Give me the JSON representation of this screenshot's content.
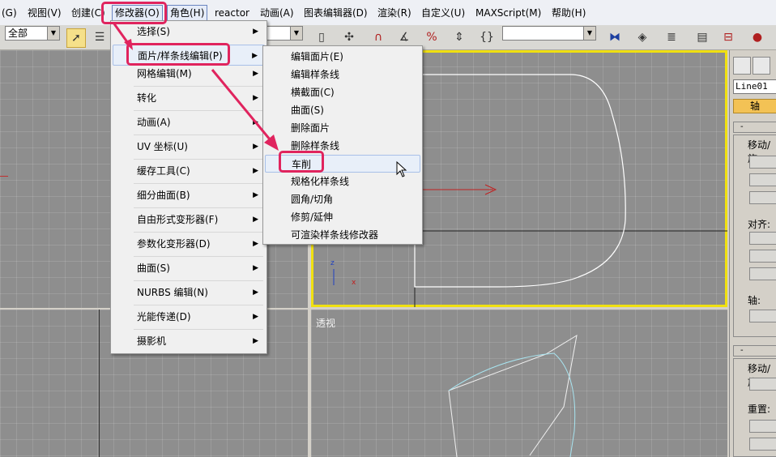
{
  "menubar": {
    "items": [
      "(G)",
      "视图(V)",
      "创建(C)",
      "修改器(O)",
      "角色(H)",
      "reactor",
      "动画(A)",
      "图表编辑器(D)",
      "渲染(R)",
      "自定义(U)",
      "MAXScript(M)",
      "帮助(H)"
    ]
  },
  "toolbar": {
    "selection_filter": "全部"
  },
  "modifier_menu": {
    "items": [
      "选择(S)",
      "面片/样条线编辑(P)",
      "网格编辑(M)",
      "转化",
      "动画(A)",
      "UV 坐标(U)",
      "缓存工具(C)",
      "细分曲面(B)",
      "自由形式变形器(F)",
      "参数化变形器(D)",
      "曲面(S)",
      "NURBS 编辑(N)",
      "光能传递(D)",
      "摄影机"
    ]
  },
  "submenu": {
    "items": [
      "编辑面片(E)",
      "编辑样条线",
      "横截面(C)",
      "曲面(S)",
      "删除面片",
      "删除样条线",
      "车削",
      "规格化样条线",
      "圆角/切角",
      "修剪/延伸",
      "可渲染样条线修改器"
    ]
  },
  "viewport": {
    "perspective_label": "透视",
    "axis_z": "z",
    "axis_x": "x"
  },
  "command_panel": {
    "object_name": "Line01",
    "pivot_tab": "轴",
    "section_move": "移动/旋",
    "section_align": "对齐:",
    "section_pivot": "轴:",
    "section_move2": "移动/旋",
    "section_reset": "重置:",
    "rollout_minus": "-"
  },
  "colors": {
    "highlight_box": "#e0245e",
    "viewport_bg": "#8e8e8e",
    "active_viewport_border": "#f0e010"
  }
}
